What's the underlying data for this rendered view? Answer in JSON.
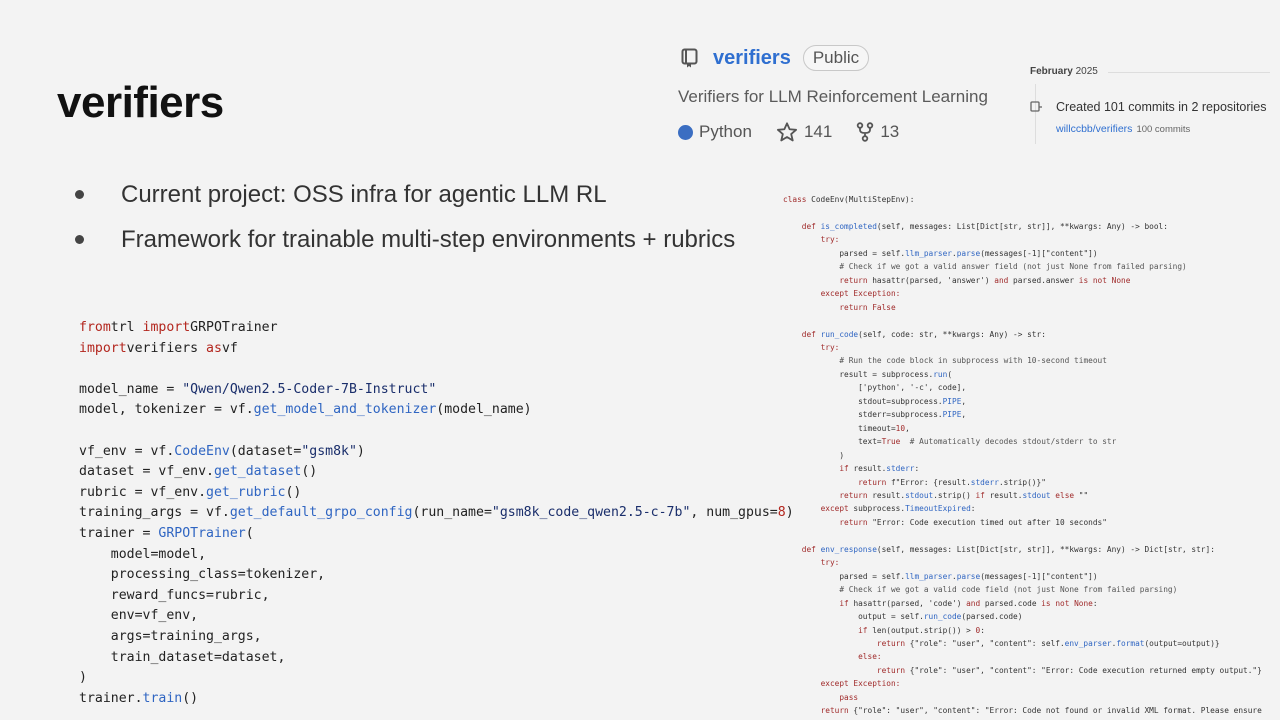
{
  "slide": {
    "title": "verifiers",
    "bullets": [
      "Current project: OSS infra for agentic LLM RL",
      "Framework for trainable multi-step environments + rubrics"
    ]
  },
  "repo_card": {
    "name": "verifiers",
    "visibility": "Public",
    "description": "Verifiers for LLM Reinforcement Learning",
    "language": "Python",
    "language_color": "#3b6ec2",
    "stars": "141",
    "forks": "13"
  },
  "activity": {
    "month": "February",
    "year": "2025",
    "summary": "Created 101 commits in 2 repositories",
    "repo_link": "willccbb/verifiers",
    "repo_commits": "100 commits"
  },
  "code_left": {
    "lines": [
      [
        [
          "kw",
          "from"
        ],
        [
          "",
          "trl "
        ],
        [
          "kw",
          "import"
        ],
        [
          "",
          "GRPOTrainer"
        ]
      ],
      [
        [
          "kw",
          "import"
        ],
        [
          "",
          "verifiers "
        ],
        [
          "kw",
          "as"
        ],
        [
          "",
          "vf"
        ]
      ],
      [],
      [
        [
          "",
          "model_name = "
        ],
        [
          "str",
          "\"Qwen/Qwen2.5-Coder-7B-Instruct\""
        ]
      ],
      [
        [
          "",
          "model, tokenizer = vf."
        ],
        [
          "fn",
          "get_model_and_tokenizer"
        ],
        [
          "",
          "(model_name)"
        ]
      ],
      [],
      [
        [
          "",
          "vf_env = vf."
        ],
        [
          "fn",
          "CodeEnv"
        ],
        [
          "",
          "(dataset="
        ],
        [
          "str",
          "\"gsm8k\""
        ],
        [
          "",
          ")"
        ]
      ],
      [
        [
          "",
          "dataset = vf_env."
        ],
        [
          "fn",
          "get_dataset"
        ],
        [
          "",
          "()"
        ]
      ],
      [
        [
          "",
          "rubric = vf_env."
        ],
        [
          "fn",
          "get_rubric"
        ],
        [
          "",
          "()"
        ]
      ],
      [
        [
          "",
          "training_args = vf."
        ],
        [
          "fn",
          "get_default_grpo_config"
        ],
        [
          "",
          "(run_name="
        ],
        [
          "str",
          "\"gsm8k_code_qwen2.5-c-7b\""
        ],
        [
          "",
          ", num_gpus="
        ],
        [
          "kw",
          "8"
        ],
        [
          "",
          ")"
        ]
      ],
      [
        [
          "",
          "trainer = "
        ],
        [
          "fn",
          "GRPOTrainer"
        ],
        [
          "",
          "("
        ]
      ],
      [
        [
          "",
          "    model=model,"
        ]
      ],
      [
        [
          "",
          "    processing_class=tokenizer,"
        ]
      ],
      [
        [
          "",
          "    reward_funcs=rubric,"
        ]
      ],
      [
        [
          "",
          "    env=vf_env,"
        ]
      ],
      [
        [
          "",
          "    args=training_args,"
        ]
      ],
      [
        [
          "",
          "    train_dataset=dataset,"
        ]
      ],
      [
        [
          "",
          ")"
        ]
      ],
      [
        [
          "",
          "trainer."
        ],
        [
          "fn",
          "train"
        ],
        [
          "",
          "()"
        ]
      ]
    ]
  },
  "code_right": {
    "lines": [
      [
        [
          "k",
          "class "
        ],
        [
          "s",
          "CodeEnv(MultiStepEnv):"
        ]
      ],
      [],
      [
        [
          "",
          "    "
        ],
        [
          "k",
          "def "
        ],
        [
          "f",
          "is_completed"
        ],
        [
          "s",
          "(self, messages: List[Dict[str, str]], **kwargs: Any) -> bool:"
        ]
      ],
      [
        [
          "",
          "        "
        ],
        [
          "k",
          "try:"
        ]
      ],
      [
        [
          "",
          "            "
        ],
        [
          "s",
          "parsed = self."
        ],
        [
          "f",
          "llm_parser"
        ],
        [
          "s",
          "."
        ],
        [
          "f",
          "parse"
        ],
        [
          "s",
          "(messages[-1][\"content\"])"
        ]
      ],
      [
        [
          "",
          "            "
        ],
        [
          "c",
          "# Check if we got a valid answer field (not just None from failed parsing)"
        ]
      ],
      [
        [
          "",
          "            "
        ],
        [
          "k",
          "return "
        ],
        [
          "s",
          "hasattr(parsed, 'answer') "
        ],
        [
          "k",
          "and "
        ],
        [
          "s",
          "parsed.answer "
        ],
        [
          "k",
          "is not None"
        ]
      ],
      [
        [
          "",
          "        "
        ],
        [
          "k",
          "except Exception:"
        ]
      ],
      [
        [
          "",
          "            "
        ],
        [
          "k",
          "return False"
        ]
      ],
      [],
      [
        [
          "",
          "    "
        ],
        [
          "k",
          "def "
        ],
        [
          "f",
          "run_code"
        ],
        [
          "s",
          "(self, code: str, **kwargs: Any) -> str:"
        ]
      ],
      [
        [
          "",
          "        "
        ],
        [
          "k",
          "try:"
        ]
      ],
      [
        [
          "",
          "            "
        ],
        [
          "c",
          "# Run the code block in subprocess with 10-second timeout"
        ]
      ],
      [
        [
          "",
          "            "
        ],
        [
          "s",
          "result = subprocess."
        ],
        [
          "f",
          "run"
        ],
        [
          "s",
          "("
        ]
      ],
      [
        [
          "",
          "                "
        ],
        [
          "s",
          "['python', '-c', code],"
        ]
      ],
      [
        [
          "",
          "                "
        ],
        [
          "s",
          "stdout=subprocess."
        ],
        [
          "f",
          "PIPE"
        ],
        [
          "s",
          ","
        ]
      ],
      [
        [
          "",
          "                "
        ],
        [
          "s",
          "stderr=subprocess."
        ],
        [
          "f",
          "PIPE"
        ],
        [
          "s",
          ","
        ]
      ],
      [
        [
          "",
          "                "
        ],
        [
          "s",
          "timeout="
        ],
        [
          "k",
          "10"
        ],
        [
          "s",
          ","
        ]
      ],
      [
        [
          "",
          "                "
        ],
        [
          "s",
          "text="
        ],
        [
          "k",
          "True"
        ],
        [
          "c",
          "  # Automatically decodes stdout/stderr to str"
        ]
      ],
      [
        [
          "",
          "            "
        ],
        [
          "s",
          ")"
        ]
      ],
      [
        [
          "",
          "            "
        ],
        [
          "k",
          "if "
        ],
        [
          "s",
          "result."
        ],
        [
          "f",
          "stderr"
        ],
        [
          "s",
          ":"
        ]
      ],
      [
        [
          "",
          "                "
        ],
        [
          "k",
          "return "
        ],
        [
          "s",
          "f\"Error: {result."
        ],
        [
          "f",
          "stderr"
        ],
        [
          "s",
          ".strip()}\""
        ]
      ],
      [
        [
          "",
          "            "
        ],
        [
          "k",
          "return "
        ],
        [
          "s",
          "result."
        ],
        [
          "f",
          "stdout"
        ],
        [
          "s",
          ".strip() "
        ],
        [
          "k",
          "if "
        ],
        [
          "s",
          "result."
        ],
        [
          "f",
          "stdout"
        ],
        [
          "k",
          " else "
        ],
        [
          "s",
          "\"\""
        ]
      ],
      [
        [
          "",
          "        "
        ],
        [
          "k",
          "except "
        ],
        [
          "s",
          "subprocess."
        ],
        [
          "f",
          "TimeoutExpired"
        ],
        [
          "s",
          ":"
        ]
      ],
      [
        [
          "",
          "            "
        ],
        [
          "k",
          "return "
        ],
        [
          "s",
          "\"Error: Code execution timed out after 10 seconds\""
        ]
      ],
      [],
      [
        [
          "",
          "    "
        ],
        [
          "k",
          "def "
        ],
        [
          "f",
          "env_response"
        ],
        [
          "s",
          "(self, messages: List[Dict[str, str]], **kwargs: Any) -> Dict[str, str]:"
        ]
      ],
      [
        [
          "",
          "        "
        ],
        [
          "k",
          "try:"
        ]
      ],
      [
        [
          "",
          "            "
        ],
        [
          "s",
          "parsed = self."
        ],
        [
          "f",
          "llm_parser"
        ],
        [
          "s",
          "."
        ],
        [
          "f",
          "parse"
        ],
        [
          "s",
          "(messages[-1][\"content\"])"
        ]
      ],
      [
        [
          "",
          "            "
        ],
        [
          "c",
          "# Check if we got a valid code field (not just None from failed parsing)"
        ]
      ],
      [
        [
          "",
          "            "
        ],
        [
          "k",
          "if "
        ],
        [
          "s",
          "hasattr(parsed, 'code') "
        ],
        [
          "k",
          "and "
        ],
        [
          "s",
          "parsed.code "
        ],
        [
          "k",
          "is not None"
        ],
        [
          "s",
          ":"
        ]
      ],
      [
        [
          "",
          "                "
        ],
        [
          "s",
          "output = self."
        ],
        [
          "f",
          "run_code"
        ],
        [
          "s",
          "(parsed.code)"
        ]
      ],
      [
        [
          "",
          "                "
        ],
        [
          "k",
          "if "
        ],
        [
          "s",
          "len(output.strip()) > "
        ],
        [
          "k",
          "0"
        ],
        [
          "s",
          ":"
        ]
      ],
      [
        [
          "",
          "                    "
        ],
        [
          "k",
          "return "
        ],
        [
          "s",
          "{\"role\": \"user\", \"content\": self."
        ],
        [
          "f",
          "env_parser"
        ],
        [
          "s",
          "."
        ],
        [
          "f",
          "format"
        ],
        [
          "s",
          "(output=output)}"
        ]
      ],
      [
        [
          "",
          "                "
        ],
        [
          "k",
          "else:"
        ]
      ],
      [
        [
          "",
          "                    "
        ],
        [
          "k",
          "return "
        ],
        [
          "s",
          "{\"role\": \"user\", \"content\": \"Error: Code execution returned empty output.\"}"
        ]
      ],
      [
        [
          "",
          "        "
        ],
        [
          "k",
          "except Exception:"
        ]
      ],
      [
        [
          "",
          "            "
        ],
        [
          "k",
          "pass"
        ]
      ],
      [
        [
          "",
          "        "
        ],
        [
          "k",
          "return "
        ],
        [
          "s",
          "{\"role\": \"user\", \"content\": \"Error: Code not found or invalid XML format. Please ensure"
        ]
      ]
    ]
  }
}
